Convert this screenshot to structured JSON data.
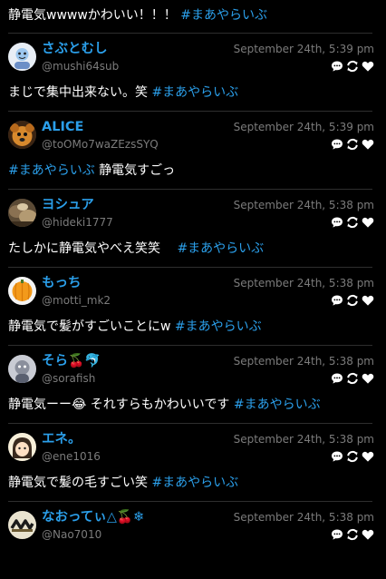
{
  "top_partial": {
    "text": "静電気wwwwかわいい！！！ ",
    "hashtag": "#まあやらいぶ"
  },
  "icons": {
    "reply": "reply-bubble-icon",
    "retweet": "retweet-icon",
    "like": "heart-icon"
  },
  "colors": {
    "background": "#000000",
    "accent": "#2b9fea",
    "muted": "#7b7b7b",
    "divider": "#2e2e2e"
  },
  "tweets": [
    {
      "name": "さぶとむし",
      "handle": "@mushi64sub",
      "time": "September 24th, 5:39 pm",
      "text": "まじで集中出来ない。笑 ",
      "hashtag": "#まあやらいぶ",
      "avatar": "cartoon-avatar"
    },
    {
      "name": "ALICE",
      "handle": "@toOMo7waZEzsSYQ",
      "time": "September 24th, 5:39 pm",
      "text": " 静電気すごっ",
      "hashtag": "#まあやらいぶ",
      "avatar": "dog-avatar"
    },
    {
      "name": "ヨシュア",
      "handle": "@hideki1777",
      "time": "September 24th, 5:38 pm",
      "text": "たしかに静電気やべえ笑笑　 ",
      "hashtag": "#まあやらいぶ",
      "avatar": "photo-avatar"
    },
    {
      "name": "もっち",
      "handle": "@motti_mk2",
      "time": "September 24th, 5:38 pm",
      "text": "静電気で髪がすごいことにw ",
      "hashtag": "#まあやらいぶ",
      "avatar": "orange-avatar"
    },
    {
      "name": "そら🍒🐬",
      "handle": "@sorafish",
      "time": "September 24th, 5:38 pm",
      "text": "静電気ーー😂 それすらもかわいいです ",
      "hashtag": "#まあやらいぶ",
      "avatar": "character-avatar"
    },
    {
      "name": "エネ。",
      "handle": "@ene1016",
      "time": "September 24th, 5:38 pm",
      "text": "静電気で髪の毛すごい笑 ",
      "hashtag": "#まあやらいぶ",
      "avatar": "anime-avatar"
    },
    {
      "name": "なおってぃ△🍒❄",
      "handle": "@Nao7010",
      "time": "September 24th, 5:38 pm",
      "text": "",
      "hashtag": "",
      "avatar": "logo-avatar"
    }
  ]
}
